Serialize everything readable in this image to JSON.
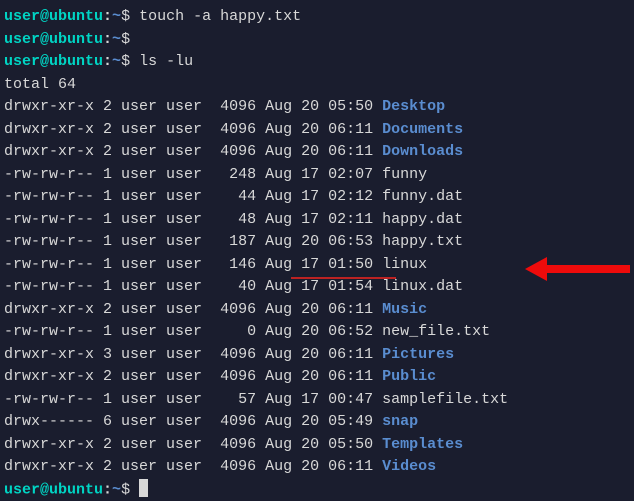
{
  "prompt": {
    "user": "user@ubuntu",
    "sep": ":",
    "path": "~",
    "symbol": "$"
  },
  "commands": {
    "cmd1": " touch -a happy.txt",
    "cmd2": "",
    "cmd3": " ls -lu"
  },
  "total_line": "total 64",
  "rows": [
    {
      "perm": "drwxr-xr-x",
      "links": "2",
      "owner": "user",
      "group": "user",
      "size": "4096",
      "date": "Aug 20 05:50",
      "name": "Desktop",
      "type": "dir"
    },
    {
      "perm": "drwxr-xr-x",
      "links": "2",
      "owner": "user",
      "group": "user",
      "size": "4096",
      "date": "Aug 20 06:11",
      "name": "Documents",
      "type": "dir"
    },
    {
      "perm": "drwxr-xr-x",
      "links": "2",
      "owner": "user",
      "group": "user",
      "size": "4096",
      "date": "Aug 20 06:11",
      "name": "Downloads",
      "type": "dir"
    },
    {
      "perm": "-rw-rw-r--",
      "links": "1",
      "owner": "user",
      "group": "user",
      "size": "248",
      "date": "Aug 17 02:07",
      "name": "funny",
      "type": "file"
    },
    {
      "perm": "-rw-rw-r--",
      "links": "1",
      "owner": "user",
      "group": "user",
      "size": "44",
      "date": "Aug 17 02:12",
      "name": "funny.dat",
      "type": "file"
    },
    {
      "perm": "-rw-rw-r--",
      "links": "1",
      "owner": "user",
      "group": "user",
      "size": "48",
      "date": "Aug 17 02:11",
      "name": "happy.dat",
      "type": "file"
    },
    {
      "perm": "-rw-rw-r--",
      "links": "1",
      "owner": "user",
      "group": "user",
      "size": "187",
      "date": "Aug 20 06:53",
      "name": "happy.txt",
      "type": "file"
    },
    {
      "perm": "-rw-rw-r--",
      "links": "1",
      "owner": "user",
      "group": "user",
      "size": "146",
      "date": "Aug 17 01:50",
      "name": "linux",
      "type": "file"
    },
    {
      "perm": "-rw-rw-r--",
      "links": "1",
      "owner": "user",
      "group": "user",
      "size": "40",
      "date": "Aug 17 01:54",
      "name": "linux.dat",
      "type": "file"
    },
    {
      "perm": "drwxr-xr-x",
      "links": "2",
      "owner": "user",
      "group": "user",
      "size": "4096",
      "date": "Aug 20 06:11",
      "name": "Music",
      "type": "dir"
    },
    {
      "perm": "-rw-rw-r--",
      "links": "1",
      "owner": "user",
      "group": "user",
      "size": "0",
      "date": "Aug 20 06:52",
      "name": "new_file.txt",
      "type": "file"
    },
    {
      "perm": "drwxr-xr-x",
      "links": "3",
      "owner": "user",
      "group": "user",
      "size": "4096",
      "date": "Aug 20 06:11",
      "name": "Pictures",
      "type": "dir"
    },
    {
      "perm": "drwxr-xr-x",
      "links": "2",
      "owner": "user",
      "group": "user",
      "size": "4096",
      "date": "Aug 20 06:11",
      "name": "Public",
      "type": "dir"
    },
    {
      "perm": "-rw-rw-r--",
      "links": "1",
      "owner": "user",
      "group": "user",
      "size": "57",
      "date": "Aug 17 00:47",
      "name": "samplefile.txt",
      "type": "file"
    },
    {
      "perm": "drwx------",
      "links": "6",
      "owner": "user",
      "group": "user",
      "size": "4096",
      "date": "Aug 20 05:49",
      "name": "snap",
      "type": "dir"
    },
    {
      "perm": "drwxr-xr-x",
      "links": "2",
      "owner": "user",
      "group": "user",
      "size": "4096",
      "date": "Aug 20 05:50",
      "name": "Templates",
      "type": "dir"
    },
    {
      "perm": "drwxr-xr-x",
      "links": "2",
      "owner": "user",
      "group": "user",
      "size": "4096",
      "date": "Aug 20 06:11",
      "name": "Videos",
      "type": "dir"
    }
  ]
}
